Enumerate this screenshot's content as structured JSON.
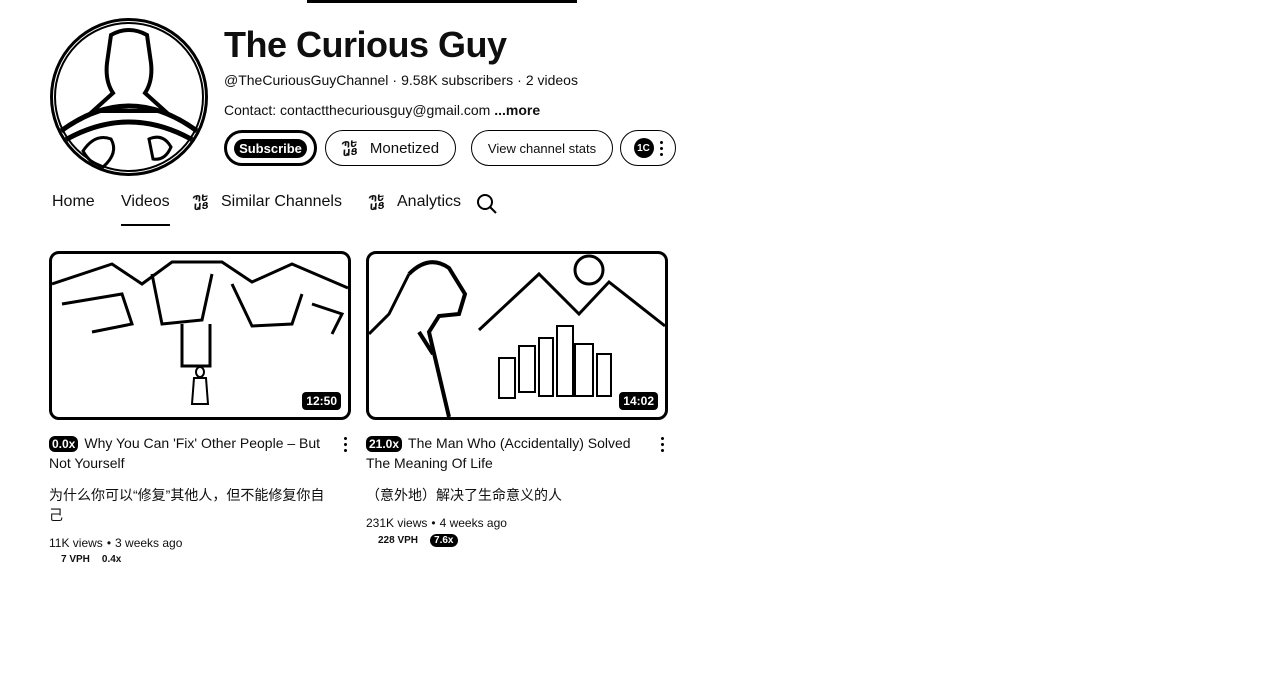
{
  "channel": {
    "name": "The Curious Guy",
    "handle": "@TheCuriousGuyChannel",
    "subscribers": "9.58K subscribers",
    "videos_count": "2 videos",
    "contact": "Contact: contactthecuriousguy@gmail.com",
    "more_label": "...more"
  },
  "buttons": {
    "subscribe": "Subscribe",
    "monetized": "Monetized",
    "view_stats": "View channel stats",
    "ext_label": "1C"
  },
  "tabs": {
    "home": "Home",
    "videos": "Videos",
    "similar": "Similar Channels",
    "analytics": "Analytics"
  },
  "videos": [
    {
      "outlier": "0.0x",
      "title": "Why You Can 'Fix' Other People – But Not Yourself",
      "cn_title": "为什么你可以“修复”其他人，但不能修复你自己",
      "duration": "12:50",
      "views": "11K views",
      "age": "3 weeks ago",
      "vph": "7 VPH",
      "multiplier": "0.4x"
    },
    {
      "outlier": "21.0x",
      "title": "The Man Who (Accidentally) Solved The Meaning Of Life",
      "cn_title": "（意外地）解决了生命意义的人",
      "duration": "14:02",
      "views": "231K views",
      "age": "4 weeks ago",
      "vph": "228 VPH",
      "multiplier": "7.6x"
    }
  ],
  "icons": {
    "search": "search-icon",
    "more": "more-vert-icon",
    "tool_logo": "tool-logo-icon"
  }
}
